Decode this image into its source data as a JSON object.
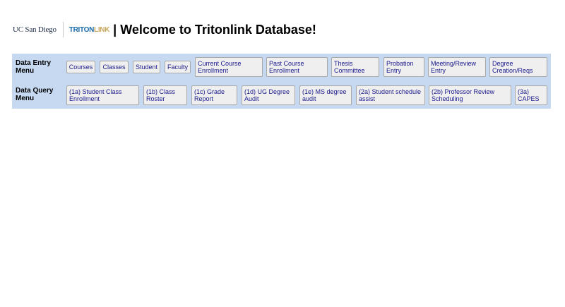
{
  "header": {
    "logo_ucsd": "UC San Diego",
    "logo_triton_a": "TRITON",
    "logo_triton_b": "LINK",
    "title": "| Welcome to Tritonlink Database!"
  },
  "data_entry_menu": {
    "label": "Data Entry Menu",
    "buttons": [
      "Courses",
      "Classes",
      "Student",
      "Faculty",
      "Current Course Enrollment",
      "Past Course Enrollment",
      "Thesis Committee",
      "Probation Entry",
      "Meeting/Review Entry",
      "Degree Creation/Reqs"
    ]
  },
  "data_query_menu": {
    "label": "Data Query Menu",
    "buttons": [
      "(1a) Student Class Enrollment",
      "(1b) Class Roster",
      "(1c) Grade Report",
      "(1d) UG Degree Audit",
      "(1e) MS degree audit",
      "(2a) Student schedule assist",
      "(2b) Professor Review Scheduling",
      "(3a) CAPES"
    ]
  },
  "colors": {
    "menu_background": "#c6d9f1",
    "button_text": "#1a1a8c",
    "button_background": "#efefef"
  }
}
